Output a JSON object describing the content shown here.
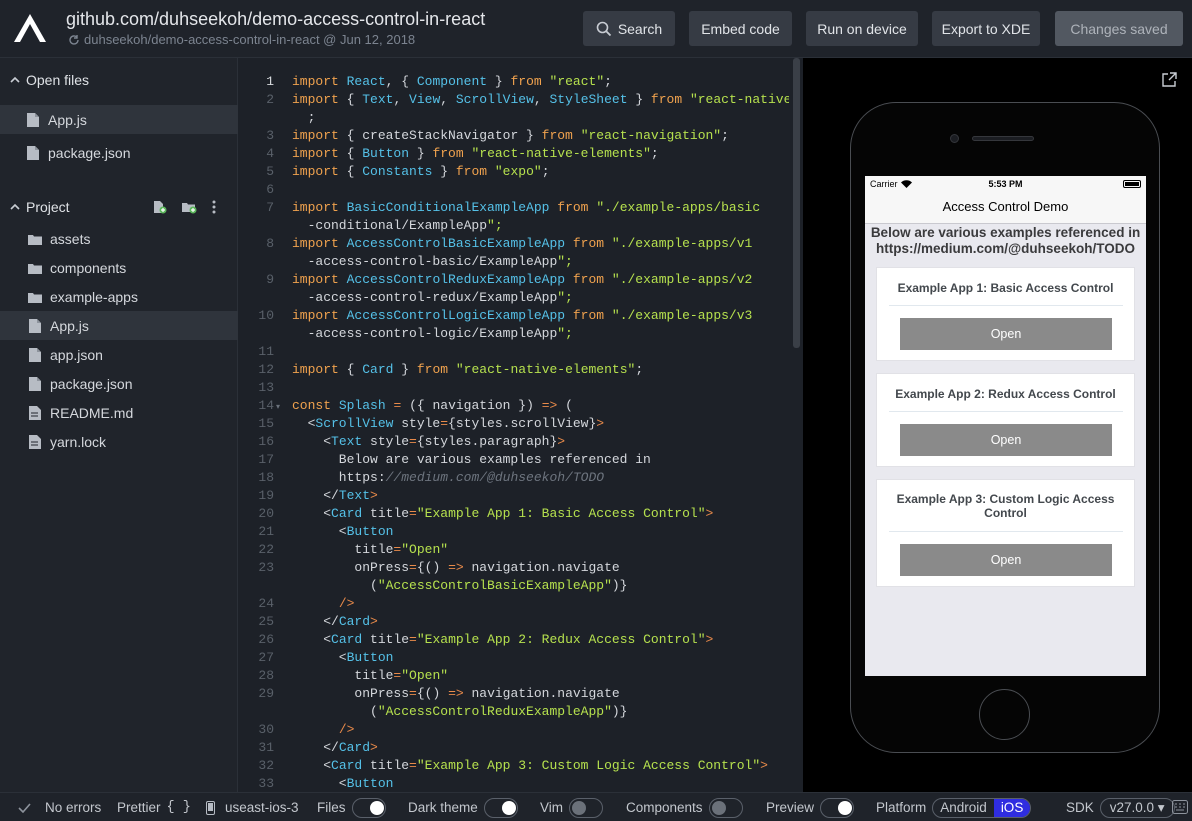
{
  "header": {
    "title": "github.com/duhseekoh/demo-access-control-in-react",
    "subtitle": "duhseekoh/demo-access-control-in-react @ Jun 12, 2018",
    "search": "Search",
    "embed": "Embed code",
    "run": "Run on device",
    "export": "Export to XDE",
    "saved": "Changes saved"
  },
  "sidebar": {
    "open_files_label": "Open files",
    "open_files": [
      "App.js",
      "package.json"
    ],
    "project_label": "Project",
    "folders": [
      "assets",
      "components",
      "example-apps"
    ],
    "files": [
      "App.js",
      "app.json",
      "package.json",
      "README.md",
      "yarn.lock"
    ]
  },
  "editor": {
    "current_line": 1,
    "lines": [
      {
        "n": "1",
        "code": "import React, { Component } from \"react\";"
      },
      {
        "n": "2",
        "code": "import { Text, View, ScrollView, StyleSheet } from \"react-native\""
      },
      {
        "n": "",
        "code": "  ;"
      },
      {
        "n": "3",
        "code": "import { createStackNavigator } from \"react-navigation\";"
      },
      {
        "n": "4",
        "code": "import { Button } from \"react-native-elements\";"
      },
      {
        "n": "5",
        "code": "import { Constants } from \"expo\";"
      },
      {
        "n": "6",
        "code": ""
      },
      {
        "n": "7",
        "code": "import BasicConditionalExampleApp from \"./example-apps/basic"
      },
      {
        "n": "",
        "code": "  -conditional/ExampleApp\";"
      },
      {
        "n": "8",
        "code": "import AccessControlBasicExampleApp from \"./example-apps/v1"
      },
      {
        "n": "",
        "code": "  -access-control-basic/ExampleApp\";"
      },
      {
        "n": "9",
        "code": "import AccessControlReduxExampleApp from \"./example-apps/v2"
      },
      {
        "n": "",
        "code": "  -access-control-redux/ExampleApp\";"
      },
      {
        "n": "10",
        "code": "import AccessControlLogicExampleApp from \"./example-apps/v3"
      },
      {
        "n": "",
        "code": "  -access-control-logic/ExampleApp\";"
      },
      {
        "n": "11",
        "code": ""
      },
      {
        "n": "12",
        "code": "import { Card } from \"react-native-elements\";"
      },
      {
        "n": "13",
        "code": ""
      },
      {
        "n": "14",
        "code": "const Splash = ({ navigation }) => (",
        "fold": true
      },
      {
        "n": "15",
        "code": "  <ScrollView style={styles.scrollView}>"
      },
      {
        "n": "16",
        "code": "    <Text style={styles.paragraph}>"
      },
      {
        "n": "17",
        "code": "      Below are various examples referenced in"
      },
      {
        "n": "18",
        "code": "      https://medium.com/@duhseekoh/TODO"
      },
      {
        "n": "19",
        "code": "    </Text>"
      },
      {
        "n": "20",
        "code": "    <Card title=\"Example App 1: Basic Access Control\">"
      },
      {
        "n": "21",
        "code": "      <Button"
      },
      {
        "n": "22",
        "code": "        title=\"Open\""
      },
      {
        "n": "23",
        "code": "        onPress={() => navigation.navigate"
      },
      {
        "n": "",
        "code": "          (\"AccessControlBasicExampleApp\")}"
      },
      {
        "n": "24",
        "code": "      />"
      },
      {
        "n": "25",
        "code": "    </Card>"
      },
      {
        "n": "26",
        "code": "    <Card title=\"Example App 2: Redux Access Control\">"
      },
      {
        "n": "27",
        "code": "      <Button"
      },
      {
        "n": "28",
        "code": "        title=\"Open\""
      },
      {
        "n": "29",
        "code": "        onPress={() => navigation.navigate"
      },
      {
        "n": "",
        "code": "          (\"AccessControlReduxExampleApp\")}"
      },
      {
        "n": "30",
        "code": "      />"
      },
      {
        "n": "31",
        "code": "    </Card>"
      },
      {
        "n": "32",
        "code": "    <Card title=\"Example App 3: Custom Logic Access Control\">"
      },
      {
        "n": "33",
        "code": "      <Button"
      }
    ]
  },
  "device": {
    "carrier": "Carrier",
    "time": "5:53 PM",
    "nav_title": "Access Control Demo",
    "paragraph_line1": "Below are various examples referenced in",
    "paragraph_line2": "https://medium.com/@duhseekoh/TODO",
    "cards": [
      {
        "title": "Example App 1: Basic Access Control",
        "button": "Open"
      },
      {
        "title": "Example App 2: Redux Access Control",
        "button": "Open"
      },
      {
        "title": "Example App 3: Custom Logic Access Control",
        "button": "Open"
      }
    ]
  },
  "footer": {
    "errors": "No errors",
    "prettier": "Prettier",
    "prettier_icon": "{ }",
    "device": "useast-ios-3",
    "files": "Files",
    "dark_theme": "Dark theme",
    "vim": "Vim",
    "components": "Components",
    "preview": "Preview",
    "platform": "Platform",
    "android": "Android",
    "ios": "iOS",
    "sdk": "SDK",
    "sdk_version": "v27.0.0 ▾"
  },
  "colors": {
    "accent_ios": "#2f2de0",
    "keyword": "#f0a24e",
    "identifier": "#55c1e8",
    "string": "#b6e14e"
  }
}
